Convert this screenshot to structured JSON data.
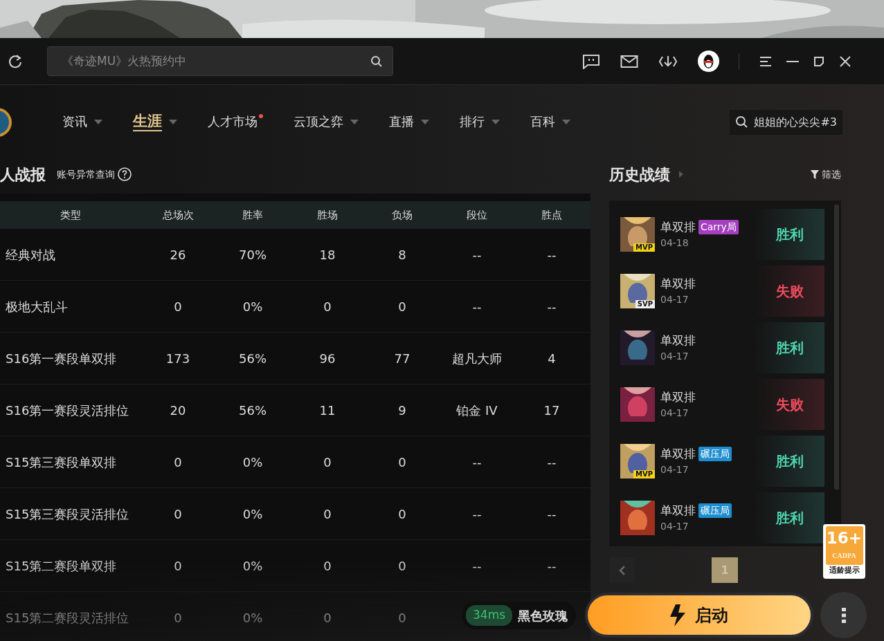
{
  "toolbar": {
    "search": {
      "placeholder": "《奇迹MU》火热预约中"
    }
  },
  "nav": {
    "tabs": [
      {
        "label": "资讯",
        "selected": false,
        "dropdown": true,
        "dot": false
      },
      {
        "label": "生涯",
        "selected": true,
        "dropdown": true,
        "dot": false
      },
      {
        "label": "人才市场",
        "selected": false,
        "dropdown": false,
        "dot": true
      },
      {
        "label": "云顶之弈",
        "selected": false,
        "dropdown": true,
        "dot": false
      },
      {
        "label": "直播",
        "selected": false,
        "dropdown": true,
        "dot": false
      },
      {
        "label": "排行",
        "selected": false,
        "dropdown": true,
        "dot": false
      },
      {
        "label": "百科",
        "selected": false,
        "dropdown": true,
        "dot": false
      }
    ],
    "player_search": {
      "value": "姐姐的心尖尖#3"
    }
  },
  "stats": {
    "title": "人战报",
    "link": "账号异常查询",
    "columns": [
      "类型",
      "总场次",
      "胜率",
      "胜场",
      "负场",
      "段位",
      "胜点"
    ],
    "rows": [
      [
        "经典对战",
        "26",
        "70%",
        "18",
        "8",
        "--",
        "--"
      ],
      [
        "极地大乱斗",
        "0",
        "0%",
        "0",
        "0",
        "--",
        "--"
      ],
      [
        "S16第一赛段单双排",
        "173",
        "56%",
        "96",
        "77",
        "超凡大师",
        "4"
      ],
      [
        "S16第一赛段灵活排位",
        "20",
        "56%",
        "11",
        "9",
        "铂金 IV",
        "17"
      ],
      [
        "S15第三赛段单双排",
        "0",
        "0%",
        "0",
        "0",
        "--",
        "--"
      ],
      [
        "S15第三赛段灵活排位",
        "0",
        "0%",
        "0",
        "0",
        "--",
        "--"
      ],
      [
        "S15第二赛段单双排",
        "0",
        "0%",
        "0",
        "0",
        "--",
        "--"
      ],
      [
        "S15第二赛段灵活排位",
        "0",
        "0%",
        "0",
        "0"
      ]
    ]
  },
  "history": {
    "title": "历史战绩",
    "filter": "筛选",
    "matches": [
      {
        "mode": "单双排",
        "tag": {
          "label": "Carry局",
          "color": "#a53fbf"
        },
        "date": "04-18",
        "medal": {
          "label": "MVP",
          "kind": "mvp"
        },
        "result": "胜利",
        "kind": "win"
      },
      {
        "mode": "单双排",
        "date": "04-17",
        "medal": {
          "label": "SVP",
          "kind": "svp"
        },
        "result": "失败",
        "kind": "loss"
      },
      {
        "mode": "单双排",
        "date": "04-17",
        "result": "胜利",
        "kind": "win"
      },
      {
        "mode": "单双排",
        "date": "04-17",
        "result": "失败",
        "kind": "loss"
      },
      {
        "mode": "单双排",
        "tag": {
          "label": "碾压局",
          "color": "#1e8ed0"
        },
        "date": "04-17",
        "medal": {
          "label": "MVP",
          "kind": "mvp"
        },
        "result": "胜利",
        "kind": "win"
      },
      {
        "mode": "单双排",
        "tag": {
          "label": "碾压局",
          "color": "#1e8ed0"
        },
        "date": "04-17",
        "result": "胜利",
        "kind": "win"
      }
    ],
    "pages": [
      {
        "label": "1",
        "selected": true
      }
    ]
  },
  "rating": {
    "age": "16+",
    "org": "CADPA",
    "caption": "适龄提示"
  },
  "ping": {
    "latency": "34ms",
    "server": "黑色玫瑰"
  },
  "launch": {
    "label": "启动"
  }
}
